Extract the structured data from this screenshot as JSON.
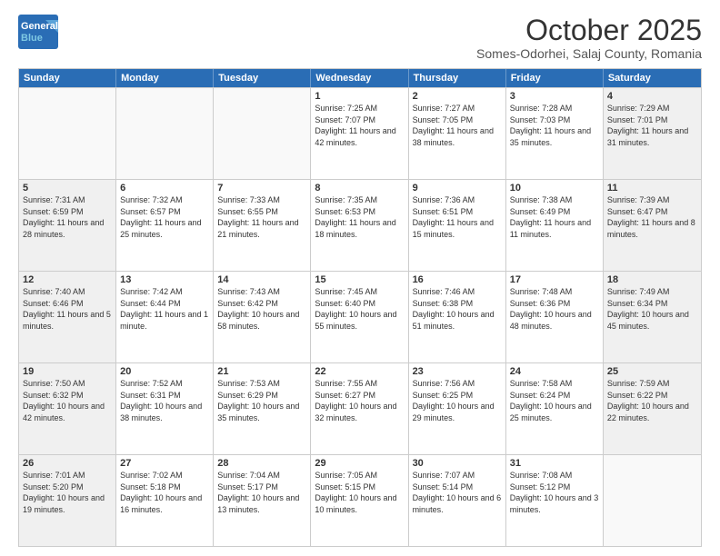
{
  "logo": {
    "general": "General",
    "blue": "Blue"
  },
  "title": "October 2025",
  "subtitle": "Somes-Odorhei, Salaj County, Romania",
  "header_days": [
    "Sunday",
    "Monday",
    "Tuesday",
    "Wednesday",
    "Thursday",
    "Friday",
    "Saturday"
  ],
  "rows": [
    [
      {
        "day": "",
        "detail": "",
        "empty": true
      },
      {
        "day": "",
        "detail": "",
        "empty": true
      },
      {
        "day": "",
        "detail": "",
        "empty": true
      },
      {
        "day": "1",
        "detail": "Sunrise: 7:25 AM\nSunset: 7:07 PM\nDaylight: 11 hours\nand 42 minutes."
      },
      {
        "day": "2",
        "detail": "Sunrise: 7:27 AM\nSunset: 7:05 PM\nDaylight: 11 hours\nand 38 minutes."
      },
      {
        "day": "3",
        "detail": "Sunrise: 7:28 AM\nSunset: 7:03 PM\nDaylight: 11 hours\nand 35 minutes."
      },
      {
        "day": "4",
        "detail": "Sunrise: 7:29 AM\nSunset: 7:01 PM\nDaylight: 11 hours\nand 31 minutes.",
        "shaded": true
      }
    ],
    [
      {
        "day": "5",
        "detail": "Sunrise: 7:31 AM\nSunset: 6:59 PM\nDaylight: 11 hours\nand 28 minutes.",
        "shaded": true
      },
      {
        "day": "6",
        "detail": "Sunrise: 7:32 AM\nSunset: 6:57 PM\nDaylight: 11 hours\nand 25 minutes."
      },
      {
        "day": "7",
        "detail": "Sunrise: 7:33 AM\nSunset: 6:55 PM\nDaylight: 11 hours\nand 21 minutes."
      },
      {
        "day": "8",
        "detail": "Sunrise: 7:35 AM\nSunset: 6:53 PM\nDaylight: 11 hours\nand 18 minutes."
      },
      {
        "day": "9",
        "detail": "Sunrise: 7:36 AM\nSunset: 6:51 PM\nDaylight: 11 hours\nand 15 minutes."
      },
      {
        "day": "10",
        "detail": "Sunrise: 7:38 AM\nSunset: 6:49 PM\nDaylight: 11 hours\nand 11 minutes."
      },
      {
        "day": "11",
        "detail": "Sunrise: 7:39 AM\nSunset: 6:47 PM\nDaylight: 11 hours\nand 8 minutes.",
        "shaded": true
      }
    ],
    [
      {
        "day": "12",
        "detail": "Sunrise: 7:40 AM\nSunset: 6:46 PM\nDaylight: 11 hours\nand 5 minutes.",
        "shaded": true
      },
      {
        "day": "13",
        "detail": "Sunrise: 7:42 AM\nSunset: 6:44 PM\nDaylight: 11 hours\nand 1 minute."
      },
      {
        "day": "14",
        "detail": "Sunrise: 7:43 AM\nSunset: 6:42 PM\nDaylight: 10 hours\nand 58 minutes."
      },
      {
        "day": "15",
        "detail": "Sunrise: 7:45 AM\nSunset: 6:40 PM\nDaylight: 10 hours\nand 55 minutes."
      },
      {
        "day": "16",
        "detail": "Sunrise: 7:46 AM\nSunset: 6:38 PM\nDaylight: 10 hours\nand 51 minutes."
      },
      {
        "day": "17",
        "detail": "Sunrise: 7:48 AM\nSunset: 6:36 PM\nDaylight: 10 hours\nand 48 minutes."
      },
      {
        "day": "18",
        "detail": "Sunrise: 7:49 AM\nSunset: 6:34 PM\nDaylight: 10 hours\nand 45 minutes.",
        "shaded": true
      }
    ],
    [
      {
        "day": "19",
        "detail": "Sunrise: 7:50 AM\nSunset: 6:32 PM\nDaylight: 10 hours\nand 42 minutes.",
        "shaded": true
      },
      {
        "day": "20",
        "detail": "Sunrise: 7:52 AM\nSunset: 6:31 PM\nDaylight: 10 hours\nand 38 minutes."
      },
      {
        "day": "21",
        "detail": "Sunrise: 7:53 AM\nSunset: 6:29 PM\nDaylight: 10 hours\nand 35 minutes."
      },
      {
        "day": "22",
        "detail": "Sunrise: 7:55 AM\nSunset: 6:27 PM\nDaylight: 10 hours\nand 32 minutes."
      },
      {
        "day": "23",
        "detail": "Sunrise: 7:56 AM\nSunset: 6:25 PM\nDaylight: 10 hours\nand 29 minutes."
      },
      {
        "day": "24",
        "detail": "Sunrise: 7:58 AM\nSunset: 6:24 PM\nDaylight: 10 hours\nand 25 minutes."
      },
      {
        "day": "25",
        "detail": "Sunrise: 7:59 AM\nSunset: 6:22 PM\nDaylight: 10 hours\nand 22 minutes.",
        "shaded": true
      }
    ],
    [
      {
        "day": "26",
        "detail": "Sunrise: 7:01 AM\nSunset: 5:20 PM\nDaylight: 10 hours\nand 19 minutes.",
        "shaded": true
      },
      {
        "day": "27",
        "detail": "Sunrise: 7:02 AM\nSunset: 5:18 PM\nDaylight: 10 hours\nand 16 minutes."
      },
      {
        "day": "28",
        "detail": "Sunrise: 7:04 AM\nSunset: 5:17 PM\nDaylight: 10 hours\nand 13 minutes."
      },
      {
        "day": "29",
        "detail": "Sunrise: 7:05 AM\nSunset: 5:15 PM\nDaylight: 10 hours\nand 10 minutes."
      },
      {
        "day": "30",
        "detail": "Sunrise: 7:07 AM\nSunset: 5:14 PM\nDaylight: 10 hours\nand 6 minutes."
      },
      {
        "day": "31",
        "detail": "Sunrise: 7:08 AM\nSunset: 5:12 PM\nDaylight: 10 hours\nand 3 minutes."
      },
      {
        "day": "",
        "detail": "",
        "empty": true,
        "shaded": true
      }
    ]
  ]
}
